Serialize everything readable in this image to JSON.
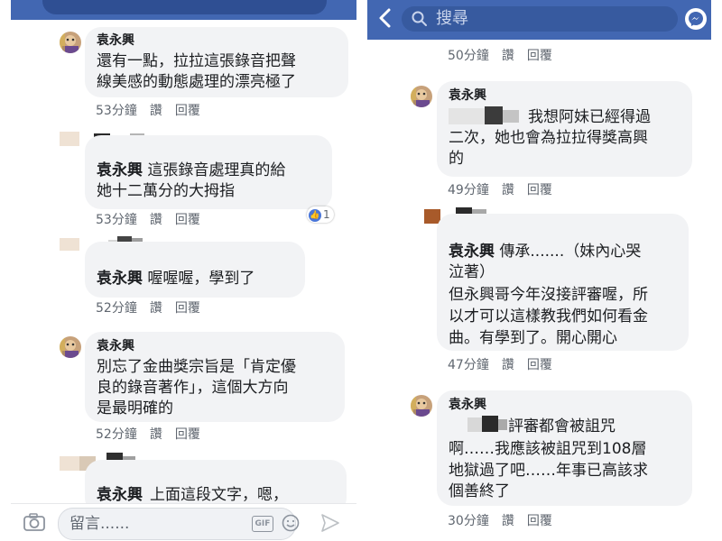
{
  "header": {
    "search_placeholder": "搜尋"
  },
  "actions": {
    "like": "讚",
    "reply": "回覆"
  },
  "left_comments": [
    {
      "author": "袁永興",
      "lines": [
        "還有一點，拉拉這張錄音把聲",
        "線美感的動態處理的漂亮極了"
      ],
      "time": "53分鐘"
    },
    {
      "tag": "袁永興",
      "lines_after_tag": [
        "這張錄音處理真的給",
        "她十二萬分的大拇指"
      ],
      "time": "53分鐘",
      "like_count": "1"
    },
    {
      "tag": "袁永興",
      "text_after_tag": "喔喔喔，學到了",
      "time": "52分鐘"
    },
    {
      "author": "袁永興",
      "lines": [
        "別忘了金曲獎宗旨是「肯定優",
        "良的錄音著作」，這個大方向",
        "是最明確的"
      ],
      "time": "52分鐘"
    },
    {
      "tag": "袁永興",
      "text_after_tag": "上面這段文字，嗯，"
    }
  ],
  "composer": {
    "placeholder": "留言......",
    "gif_label": "GIF"
  },
  "right_comments": [
    {
      "time": "50分鐘"
    },
    {
      "author": "袁永興",
      "lines": [
        "我想阿妹已經得過",
        "二次，她也會為拉拉得獎高興",
        "的"
      ],
      "time": "49分鐘"
    },
    {
      "tag": "袁永興",
      "text_after_tag": "傳承.......（妹內心哭",
      "lines": [
        "泣著）",
        "但永興哥今年沒接評審喔，所",
        "以才可以這樣教我們如何看金",
        "曲。有學到了。開心開心"
      ],
      "time": "47分鐘"
    },
    {
      "author": "袁永興",
      "lines": [
        "評審都會被詛咒",
        "啊……我應該被詛咒到108層",
        "地獄過了吧……年事已高該求",
        "個善終了"
      ],
      "time": "30分鐘"
    }
  ],
  "colors": {
    "facebook_blue": "#4267b2",
    "bubble_gray": "#f2f3f5",
    "meta_gray": "#606770"
  }
}
